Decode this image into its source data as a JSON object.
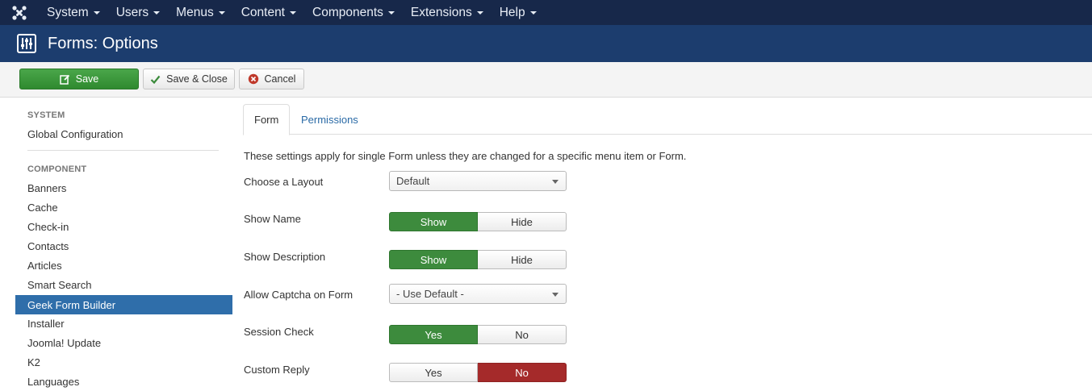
{
  "topnav": {
    "items": [
      {
        "label": "System"
      },
      {
        "label": "Users"
      },
      {
        "label": "Menus"
      },
      {
        "label": "Content"
      },
      {
        "label": "Components"
      },
      {
        "label": "Extensions"
      },
      {
        "label": "Help"
      }
    ]
  },
  "header": {
    "title": "Forms: Options"
  },
  "toolbar": {
    "save_label": "Save",
    "save_close_label": "Save & Close",
    "cancel_label": "Cancel"
  },
  "sidebar": {
    "system_heading": "SYSTEM",
    "global_config": "Global Configuration",
    "component_heading": "COMPONENT",
    "items": [
      {
        "label": "Banners"
      },
      {
        "label": "Cache"
      },
      {
        "label": "Check-in"
      },
      {
        "label": "Contacts"
      },
      {
        "label": "Articles"
      },
      {
        "label": "Smart Search"
      },
      {
        "label": "Geek Form Builder",
        "active": true
      },
      {
        "label": "Installer"
      },
      {
        "label": "Joomla! Update"
      },
      {
        "label": "K2"
      },
      {
        "label": "Languages"
      }
    ]
  },
  "tabs": {
    "form": "Form",
    "permissions": "Permissions"
  },
  "main": {
    "description": "These settings apply for single Form unless they are changed for a specific menu item or Form.",
    "layout": {
      "label": "Choose a Layout",
      "value": "Default"
    },
    "show_name": {
      "label": "Show Name",
      "on": "Show",
      "off": "Hide",
      "selected": "Show"
    },
    "show_description": {
      "label": "Show Description",
      "on": "Show",
      "off": "Hide",
      "selected": "Show"
    },
    "captcha": {
      "label": "Allow Captcha on Form",
      "value": "- Use Default -"
    },
    "session_check": {
      "label": "Session Check",
      "on": "Yes",
      "off": "No",
      "selected": "Yes"
    },
    "custom_reply": {
      "label": "Custom Reply",
      "on": "Yes",
      "off": "No",
      "selected": "No"
    }
  },
  "colors": {
    "navbar": "#17284a",
    "header": "#1c3d6e",
    "save_green": "#3d8b3d",
    "active_red": "#a52a2a",
    "sidebar_active": "#2f6eaa",
    "link_blue": "#2a6aa6"
  }
}
